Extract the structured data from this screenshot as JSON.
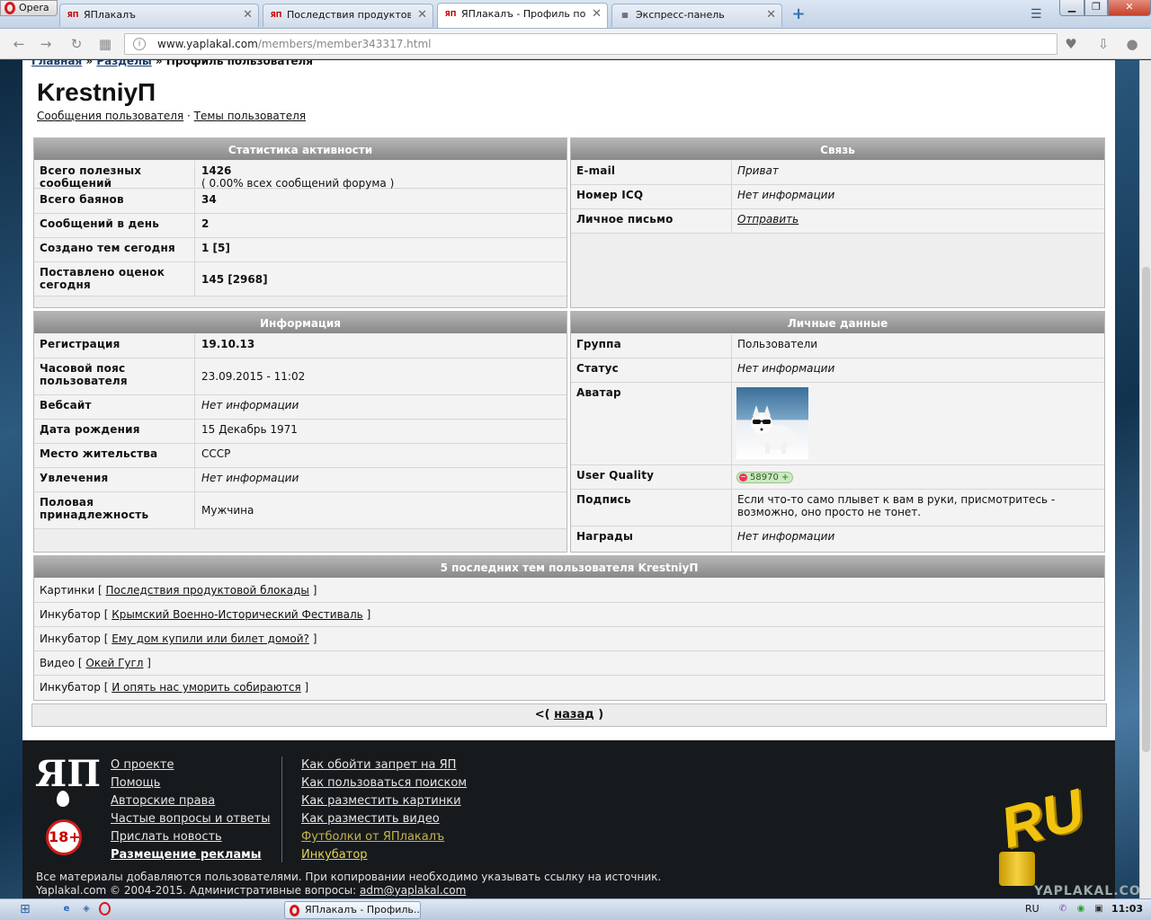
{
  "browser": {
    "opera_label": "Opera",
    "tabs": [
      {
        "icon": "",
        "title": ""
      },
      {
        "icon": "ЯП",
        "title": "ЯПлакалъ"
      },
      {
        "icon": "ЯП",
        "title": "Последствия продуктовой"
      },
      {
        "icon": "ЯП",
        "title": "ЯПлакалъ - Профиль польз"
      },
      {
        "icon": "",
        "title": "Экспресс-панель"
      }
    ],
    "url_host": "www.yaplakal.com",
    "url_path": "/members/member343317.html"
  },
  "page": {
    "breadcrumbs": [
      "Главная",
      "Разделы",
      "Профиль пользователя"
    ],
    "breadcrumb_sep": "»",
    "username": "KrestniyП",
    "user_links": [
      "Сообщения пользователя",
      "Темы пользователя"
    ],
    "user_links_sep": "·",
    "stats": {
      "title": "Статистика активности",
      "rows": [
        {
          "label": "Всего полезных сообщений",
          "value": "1426",
          "value2": "( 0.00% всех сообщений форума )"
        },
        {
          "label": "Всего баянов",
          "value": "34"
        },
        {
          "label": "Сообщений в день",
          "value": "2"
        },
        {
          "label": "Создано тем сегодня",
          "value": "1 [5]"
        },
        {
          "label": "Поставлено оценок сегодня",
          "value": "145 [2968]"
        }
      ]
    },
    "contact": {
      "title": "Связь",
      "rows": [
        {
          "label": "E-mail",
          "value": "Приват"
        },
        {
          "label": "Номер ICQ",
          "value": "Нет информации"
        },
        {
          "label": "Личное письмо",
          "value": "Отправить"
        }
      ]
    },
    "info": {
      "title": "Информация",
      "rows": [
        {
          "label": "Регистрация",
          "value": "19.10.13"
        },
        {
          "label": "Часовой пояс пользователя",
          "value": "23.09.2015 - 11:02"
        },
        {
          "label": "Вебсайт",
          "value": "Нет информации"
        },
        {
          "label": "Дата рождения",
          "value": "15 Декабрь 1971"
        },
        {
          "label": "Место жительства",
          "value": "СССР"
        },
        {
          "label": "Увлечения",
          "value": "Нет информации"
        },
        {
          "label": "Половая принадлежность",
          "value": "Мужчина"
        }
      ]
    },
    "personal": {
      "title": "Личные данные",
      "rows": [
        {
          "label": "Группа",
          "value": "Пользователи"
        },
        {
          "label": "Статус",
          "value": "Нет информации"
        },
        {
          "label": "Аватар",
          "value": ""
        },
        {
          "label": "User Quality",
          "value": "58970"
        },
        {
          "label": "Подпись",
          "value": "Если что-то само плывет к вам в руки, присмотритесь - возможно, оно просто не тонет."
        },
        {
          "label": "Награды",
          "value": "Нет информации"
        }
      ]
    },
    "topics": {
      "title": "5 последних тем пользователя KrestniyП",
      "items": [
        {
          "section": "Картинки",
          "title": "Последствия продуктовой блокады"
        },
        {
          "section": "Инкубатор",
          "title": "Крымский Военно-Исторический Фестиваль"
        },
        {
          "section": "Инкубатор",
          "title": "Ему дом купили или билет домой?"
        },
        {
          "section": "Видео",
          "title": "Окей Гугл"
        },
        {
          "section": "Инкубатор",
          "title": "И опять нас уморить собираются"
        }
      ]
    },
    "back": {
      "prefix": "<(",
      "label": "назад",
      "suffix": ")"
    }
  },
  "footer": {
    "logo": "ЯП",
    "age": "18+",
    "col1": [
      "О проекте",
      "Помощь",
      "Авторские права",
      "Частые вопросы и ответы",
      "Прислать новость",
      "Размещение рекламы"
    ],
    "col2": [
      "Как обойти запрет на ЯП",
      "Как пользоваться поиском",
      "Как разместить картинки",
      "Как разместить видео",
      "Футболки от ЯПлакалъ",
      "Инкубатор"
    ],
    "note1": "Все материалы добавляются пользователями. При копировании необходимо указывать ссылку на источник.",
    "note2_prefix": "Yaplakal.com © 2004-2015. Административные вопросы: ",
    "note2_email": "adm@yaplakal.com",
    "ru_logo": "RU",
    "watermark": "YAPLAKAL.COM"
  },
  "taskbar": {
    "opera_task": "ЯПлакалъ - Профиль...",
    "lang": "RU",
    "time": "11:03"
  },
  "colors": {
    "panel_header": "#999999",
    "link_yellow": "#e4d35a",
    "footer_bg": "#171a1d",
    "uq_badge": "#cde8c4"
  }
}
